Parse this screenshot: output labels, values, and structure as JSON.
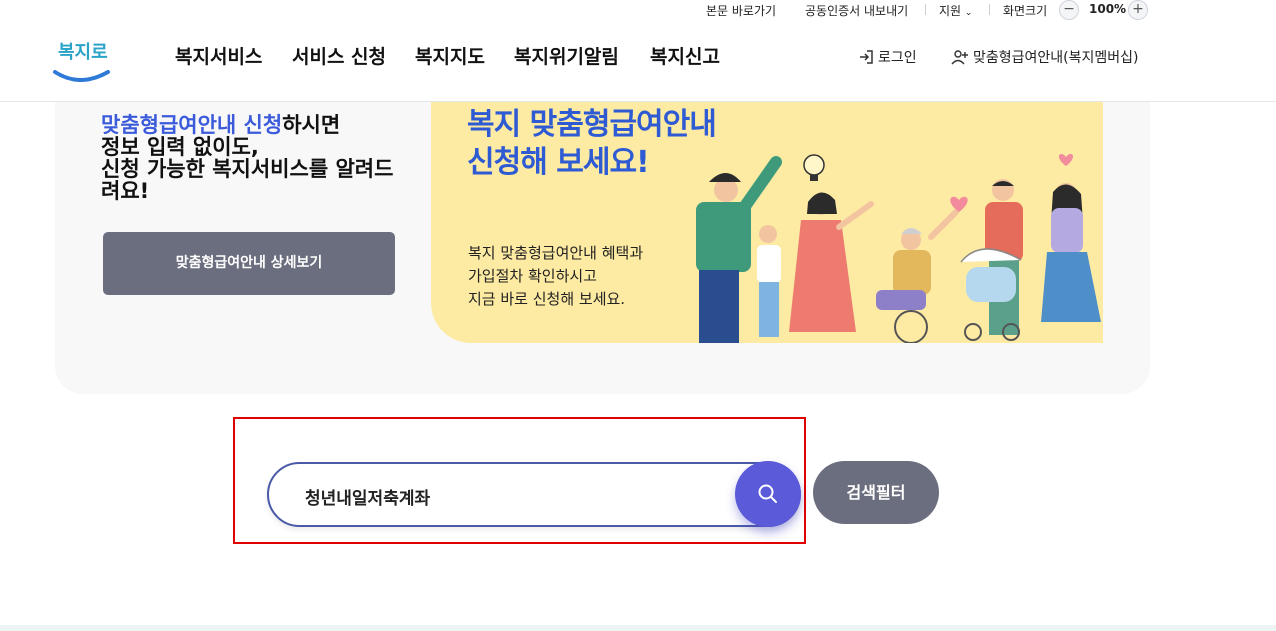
{
  "utility": {
    "skip_link": "본문 바로가기",
    "cert_export": "공동인증서 내보내기",
    "support": "지원",
    "zoom_label": "화면크기",
    "zoom_value": "100%",
    "zoom_minus": "−",
    "zoom_plus": "+"
  },
  "header": {
    "logo_text": "복지로",
    "nav": [
      "복지서비스",
      "서비스 신청",
      "복지지도",
      "복지위기알림",
      "복지신고"
    ],
    "login": "로그인",
    "membership": "맞춤형급여안내(복지멤버십)"
  },
  "hero": {
    "highlight": "맞춤형급여안내 신청",
    "line1_rest": "하시면",
    "line2": "정보 입력 없이도,",
    "line3": "신청 가능한 복지서비스를 알려드려요!",
    "detail_button": "맞춤형급여안내 상세보기"
  },
  "banner": {
    "title_line1": "복지 맞춤형급여안내",
    "title_line2": "신청해 보세요!",
    "sub_line1": "복지 맞춤형급여안내 혜택과",
    "sub_line2": "가입절차 확인하시고",
    "sub_line3": "지금 바로 신청해 보세요."
  },
  "search": {
    "value": "청년내일저축계좌",
    "filter_button": "검색필터",
    "search_icon": "search-icon"
  },
  "colors": {
    "accent_blue": "#3b5bdb",
    "search_button": "#5b5ad8",
    "gray_button": "#6b6e7e",
    "banner_bg": "#fdeaa3",
    "highlight_border": "#e00000"
  }
}
